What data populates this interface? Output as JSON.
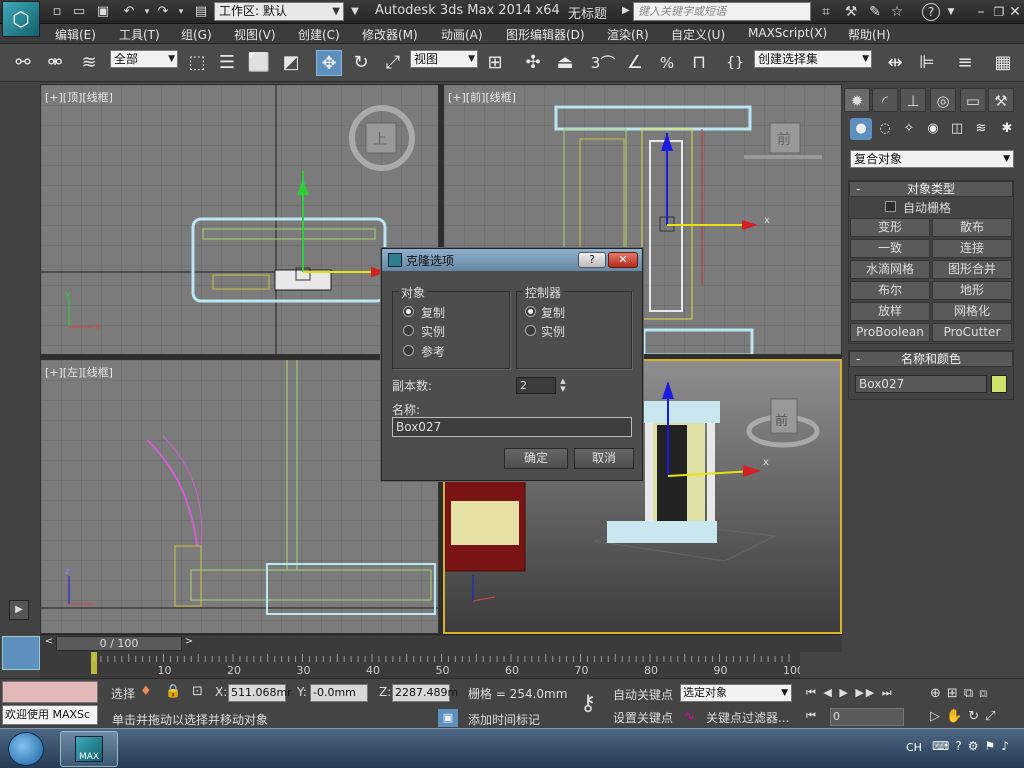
{
  "title_bar": {
    "workspace": "工作区: 默认",
    "app_title": "Autodesk 3ds Max  2014 x64",
    "doc_title": "无标题",
    "search_placeholder": "键入关键字或短语",
    "help_icon": "?"
  },
  "menu": [
    "编辑(E)",
    "工具(T)",
    "组(G)",
    "视图(V)",
    "创建(C)",
    "修改器(M)",
    "动画(A)",
    "图形编辑器(D)",
    "渲染(R)",
    "自定义(U)",
    "MAXScript(X)",
    "帮助(H)"
  ],
  "toolbar": {
    "selection_filter": "全部",
    "ref_coord": "视图",
    "named_selection": "创建选择集",
    "snap_label": "3",
    "percent_label": "%"
  },
  "viewports": {
    "top": "[+][顶][线框]",
    "front": "[+][前][线框]",
    "left": "[+][左][线框]",
    "persp_viewcube": "前",
    "top_viewcube": "上",
    "front_viewcube": "前",
    "axis_x": "x",
    "axis_y": "y",
    "axis_z": "z"
  },
  "command_panel": {
    "category": "复合对象",
    "object_type_title": "对象类型",
    "autogrid": "自动栅格",
    "buttons": [
      "变形",
      "散布",
      "一致",
      "连接",
      "水滴网格",
      "图形合并",
      "布尔",
      "地形",
      "放样",
      "网格化",
      "ProBoolean",
      "ProCutter"
    ],
    "name_color_title": "名称和颜色",
    "object_name": "Box027",
    "object_color": "#cfe36e"
  },
  "dialog": {
    "title": "克隆选项",
    "help": "?",
    "object_group": "对象",
    "object_options": [
      "复制",
      "实例",
      "参考"
    ],
    "object_selected": 0,
    "controller_group": "控制器",
    "controller_options": [
      "复制",
      "实例"
    ],
    "controller_selected": 0,
    "copies_label": "副本数:",
    "copies_value": "2",
    "name_label": "名称:",
    "name_value": "Box027",
    "ok": "确定",
    "cancel": "取消"
  },
  "timeline": {
    "frame_label": "0 / 100",
    "ticks": [
      "10",
      "20",
      "30",
      "40",
      "50",
      "60",
      "70",
      "80",
      "90",
      "100"
    ]
  },
  "status": {
    "maxscript": "欢迎使用 MAXSc",
    "select_label": "选择",
    "x_label": "X:",
    "x_value": "511.068mr",
    "y_label": "Y:",
    "y_value": "-0.0mm",
    "z_label": "Z:",
    "z_value": "2287.489m",
    "grid": "栅格 = 254.0mm",
    "prompt": "单击并拖动以选择并移动对象",
    "add_time_tag": "添加时间标记",
    "auto_key": "自动关键点",
    "set_key": "设置关键点",
    "selected_object": "选定对象",
    "key_filters": "关键点过滤器...",
    "frame_value": "0"
  },
  "taskbar": {
    "app_label": "MAX",
    "lang": "CH"
  }
}
